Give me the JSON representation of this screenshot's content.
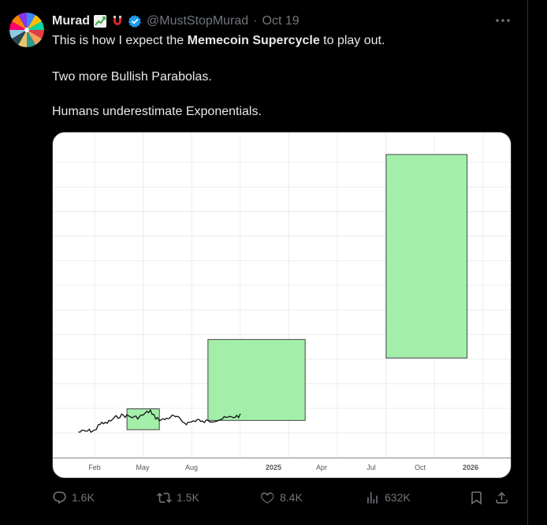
{
  "post": {
    "author_name": "Murad",
    "handle": "@MustStopMurad",
    "separator": "·",
    "date": "Oct 19",
    "line1_pre": "This is how I expect the ",
    "line1_bold": "Memecoin Supercycle",
    "line1_post": " to play out.",
    "line2": "Two more Bullish Parabolas.",
    "line3": "Humans underestimate Exponentials."
  },
  "actions": {
    "replies": "1.6K",
    "reposts": "1.5K",
    "likes": "8.4K",
    "views": "632K"
  },
  "icons": [
    "more-icon",
    "reply-icon",
    "repost-icon",
    "like-icon",
    "views-icon",
    "bookmark-icon",
    "share-icon",
    "verified-icon",
    "chart-emoji-icon",
    "magnet-emoji-icon"
  ],
  "colors": {
    "background": "#000000",
    "text": "#e7e9ea",
    "muted": "#71767b",
    "verified": "#1d9bf0",
    "box_fill": "#a3efaa",
    "box_stroke": "#444444"
  },
  "chart_data": {
    "type": "other",
    "x_ticks": [
      "Feb",
      "May",
      "Aug",
      "2025",
      "Apr",
      "Jul",
      "Oct",
      "2026"
    ],
    "grid": true,
    "boxes": [
      {
        "x_start": "2024-04",
        "x_end": "2024-06",
        "y_low": 0.1,
        "y_high": 1.0
      },
      {
        "x_start": "2024-09",
        "x_end": "2025-03",
        "y_low": 0.5,
        "y_high": 4.0
      },
      {
        "x_start": "2025-08",
        "x_end": "2026-01",
        "y_low": 3.2,
        "y_high": 12.0
      }
    ],
    "price_line_span": [
      "2024-01",
      "2024-11"
    ]
  }
}
